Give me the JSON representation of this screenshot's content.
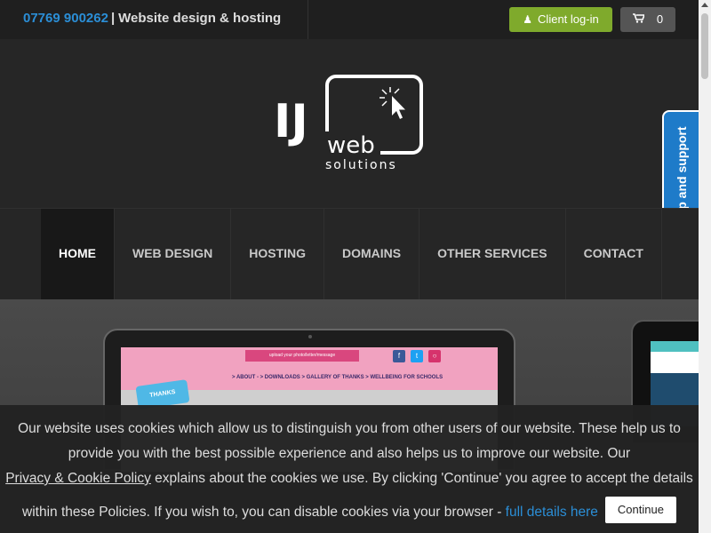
{
  "topbar": {
    "phone": "07769 900262",
    "separator": "|",
    "tagline": "Website design & hosting",
    "login_label": "Client log-in",
    "login_icon": "user-icon",
    "cart_icon": "cart-icon",
    "cart_count": "0"
  },
  "logo": {
    "letters": "IJ",
    "web": "web",
    "solutions": "solutions"
  },
  "help_tab": {
    "label": "Help and support"
  },
  "nav": {
    "items": [
      {
        "label": "HOME",
        "active": true
      },
      {
        "label": "WEB DESIGN"
      },
      {
        "label": "HOSTING"
      },
      {
        "label": "DOMAINS"
      },
      {
        "label": "OTHER SERVICES"
      },
      {
        "label": "CONTACT"
      }
    ]
  },
  "hero": {
    "screen": {
      "upload_text": "upload your photo/letter/message",
      "menu_text": "> ABOUT -   > DOWNLOADS   > GALLERY OF THANKS   > WELLBEING FOR SCHOOLS",
      "thanks_text": "THANKS"
    }
  },
  "cookie": {
    "line1": "Our website uses cookies which allow us to distinguish you from other users of our website. These help us to",
    "line2": "provide you with the best possible experience and also helps us to improve our website. Our",
    "policy_link": "Privacy & Cookie Policy",
    "line3_rest": " explains about the cookies we use. By clicking 'Continue' you agree to accept the details",
    "line4": "within these Policies. If you wish to, you can disable cookies via your browser - ",
    "details_link": "full details here",
    "continue_label": "Continue"
  },
  "colors": {
    "accent_blue": "#2b8ed6",
    "login_green": "#7faa2c",
    "help_blue": "#1e7bc9"
  }
}
